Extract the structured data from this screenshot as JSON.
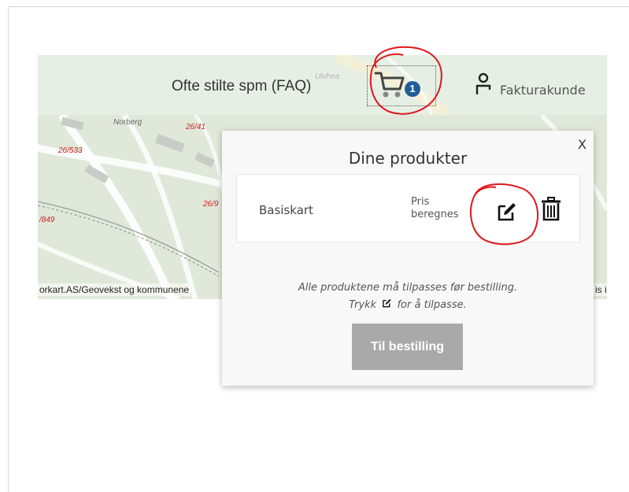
{
  "header": {
    "faq_label": "Ofte stilte spm (FAQ)",
    "cart_count": "1",
    "account_label": "Fakturakunde",
    "icons": {
      "cart": "cart-icon",
      "user": "user-icon"
    }
  },
  "map": {
    "attribution_left": "orkart.AS/Geovekst og kommunene",
    "attribution_right": "is i",
    "labels": [
      "Norberg",
      "26/41",
      "26/533",
      "26/9",
      "/849",
      "Ulvhea"
    ]
  },
  "cart_panel": {
    "close_label": "X",
    "title": "Dine produkter",
    "products": [
      {
        "name": "Basiskart",
        "price_line1": "Pris",
        "price_line2": "beregnes"
      }
    ],
    "hint_line1": "Alle produktene må tilpasses før bestilling.",
    "hint_line2_before": "Trykk",
    "hint_line2_after": "for å tilpasse.",
    "order_button": "Til bestilling"
  },
  "colors": {
    "badge": "#1e5f9a",
    "annotation": "#e0161c",
    "disabled_button": "#a9a9a9"
  }
}
